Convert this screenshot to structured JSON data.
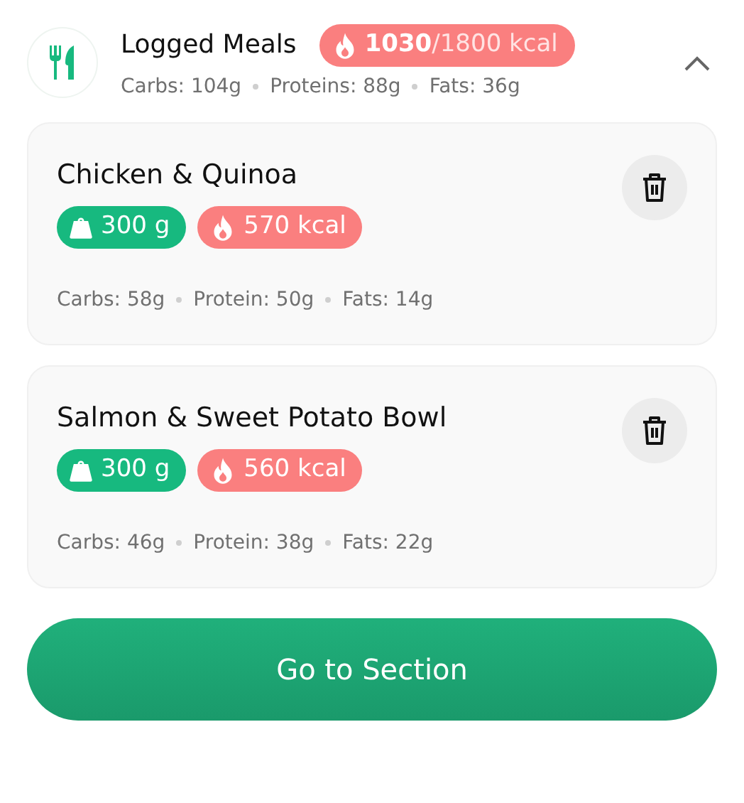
{
  "header": {
    "title": "Logged Meals",
    "calories": {
      "consumed": "1030",
      "goal": "/1800 kcal"
    },
    "macros": [
      "Carbs: 104g",
      "Proteins: 88g",
      "Fats: 36g"
    ],
    "expanded": true
  },
  "meals": [
    {
      "name": "Chicken & Quinoa",
      "weight": "300 g",
      "calories": "570 kcal",
      "macros": [
        "Carbs: 58g",
        "Protein: 50g",
        "Fats: 14g"
      ]
    },
    {
      "name": "Salmon & Sweet Potato Bowl",
      "weight": "300 g",
      "calories": "560 kcal",
      "macros": [
        "Carbs: 46g",
        "Protein: 38g",
        "Fats: 22g"
      ]
    }
  ],
  "button": {
    "label": "Go to Section"
  }
}
